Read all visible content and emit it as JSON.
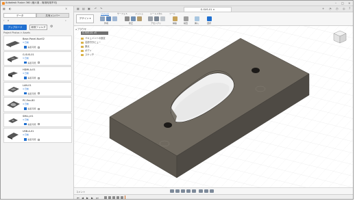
{
  "window": {
    "title": "Autodesk Fusion 360 (個人用 - 商用利用不可)"
  },
  "left_panel": {
    "tabs": [
      "データ",
      "共有メンバー"
    ],
    "upload_label": "アップロード",
    "new_folder_label": "新規フォルダ",
    "breadcrumb": "Project Photos > Assets",
    "files": [
      {
        "name": "Base-Panel-Nue02",
        "date": "3 日前",
        "badge": "編集可能"
      },
      {
        "name": "G-SUS-01",
        "date": "3 日前",
        "badge": "編集可能"
      },
      {
        "name": "HDMI-A-01",
        "date": "4 日前",
        "badge": "編集可能"
      },
      {
        "name": "LAN-01",
        "date": "4 日前",
        "badge": "編集可能"
      },
      {
        "name": "PC-Fan-80",
        "date": "4 日前",
        "badge": "編集可能"
      },
      {
        "name": "SMA-J-01",
        "date": "4 日前",
        "badge": "編集可能"
      },
      {
        "name": "USB-A-01",
        "date": "4 日前",
        "badge": "編集可能"
      }
    ]
  },
  "doc_tab": {
    "title": "G-SUS-01"
  },
  "ribbon": {
    "design_label": "デザイン",
    "tabs": [
      "ソリッド",
      "サーフェス",
      "メッシュ",
      "シートメタル",
      "ツール"
    ],
    "groups": [
      "作成",
      "修正",
      "アセンブリ",
      "構築",
      "検査",
      "挿入",
      "選択"
    ]
  },
  "browser": {
    "header": "ブラウザ",
    "root": "G-SUS-01 v5",
    "items": [
      "ドキュメントの設定",
      "名前付きビュー",
      "原点",
      "ボディ",
      "スケッチ"
    ]
  },
  "bottom": {
    "comment_label": "コメント"
  },
  "colors": {
    "accent": "#1f6fd0",
    "model_top": "#6f695f",
    "model_side": "#4e4a44"
  }
}
